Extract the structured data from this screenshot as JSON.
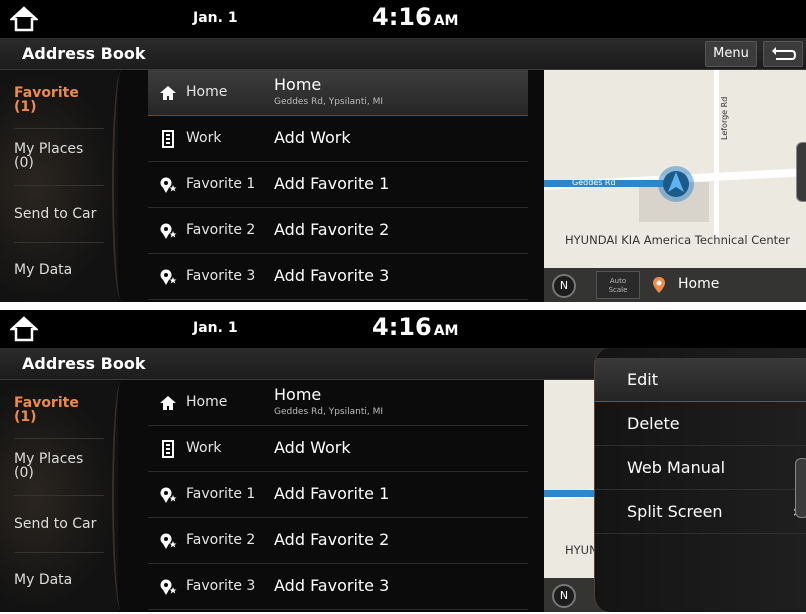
{
  "status": {
    "date": "Jan. 1",
    "time": "4:16",
    "ampm": "AM"
  },
  "header": {
    "title": "Address Book",
    "menu_label": "Menu"
  },
  "sidebar": {
    "items": [
      {
        "label": "Favorite\n(1)",
        "active": true
      },
      {
        "label": "My Places\n(0)",
        "active": false
      },
      {
        "label": "Send to Car",
        "active": false
      },
      {
        "label": "My Data",
        "active": false
      }
    ]
  },
  "list": {
    "rows": [
      {
        "icon": "home-icon",
        "type": "Home",
        "name": "Home",
        "address": "Geddes Rd, Ypsilanti, MI"
      },
      {
        "icon": "building-icon",
        "type": "Work",
        "name": "Add Work"
      },
      {
        "icon": "favorite-pin-icon",
        "type": "Favorite 1",
        "name": "Add Favorite 1"
      },
      {
        "icon": "favorite-pin-icon",
        "type": "Favorite 2",
        "name": "Add Favorite 2"
      },
      {
        "icon": "favorite-pin-icon",
        "type": "Favorite 3",
        "name": "Add Favorite 3"
      }
    ]
  },
  "map": {
    "road_geddes": "Geddes Rd",
    "road_leforge": "Leforge Rd",
    "poi": "HYUNDAI KIA America Technical Center",
    "poi_cropped": "HYUND",
    "compass": "N",
    "auto_scale": "Auto\nScale",
    "destination": "Home"
  },
  "popup": {
    "items": [
      {
        "label": "Edit"
      },
      {
        "label": "Delete"
      },
      {
        "label": "Web Manual"
      },
      {
        "label": "Split Screen"
      }
    ]
  },
  "colors": {
    "accent": "#f08a4b",
    "background": "#0b0b0b"
  }
}
